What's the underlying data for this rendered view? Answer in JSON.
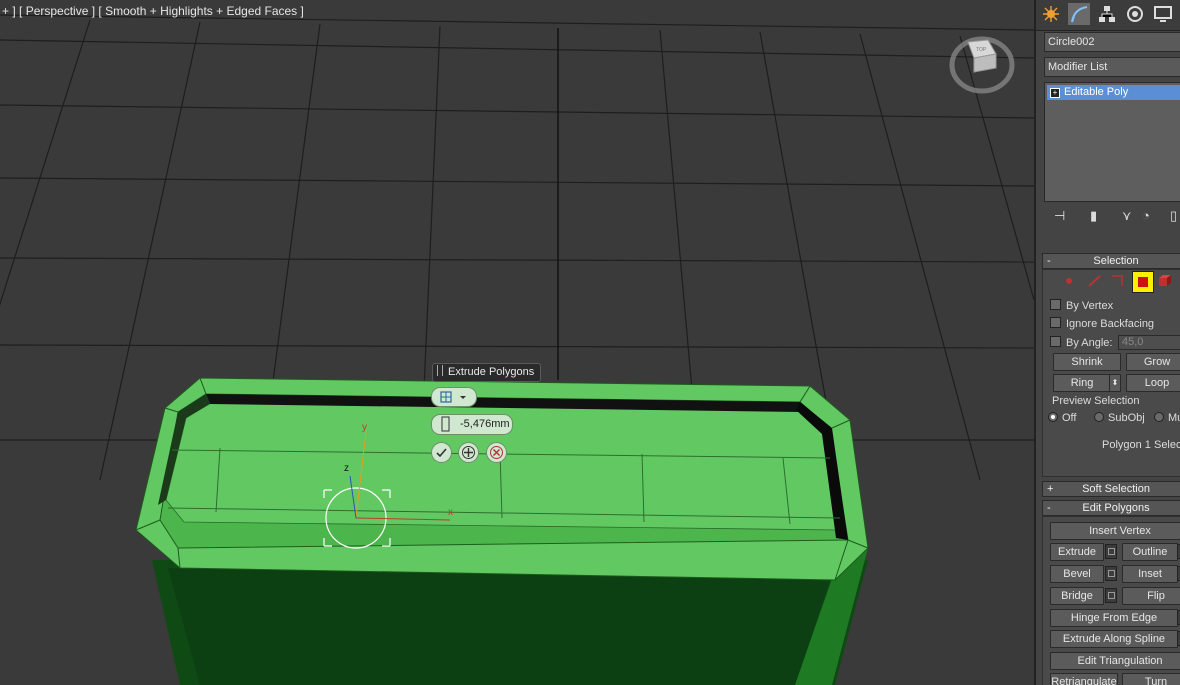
{
  "viewport": {
    "label_parts": [
      "+ ]",
      "[ Perspective ]",
      "[ Smooth + Highlights + Edged Faces ]"
    ],
    "viewcube_label": "TOP"
  },
  "caddy": {
    "title": "Extrude Polygons",
    "height_value": "-5,476mm",
    "ok_icon": "check-icon",
    "apply_icon": "plus-icon",
    "cancel_icon": "x-icon"
  },
  "panel": {
    "tabs": [
      "create-icon",
      "modify-icon",
      "hierarchy-icon",
      "motion-icon",
      "display-icon"
    ],
    "object_name": "Circle002",
    "modifier_list": "Modifier List",
    "stack_item": "Editable Poly",
    "selection": {
      "title": "Selection",
      "by_vertex": "By Vertex",
      "ignore_backfacing": "Ignore Backfacing",
      "by_angle": "By Angle:",
      "angle_value": "45,0",
      "shrink": "Shrink",
      "grow": "Grow",
      "ring": "Ring",
      "loop": "Loop",
      "preview_selection": "Preview Selection",
      "preview_off": "Off",
      "preview_subobj": "SubObj",
      "preview_multi": "Mu",
      "status": "Polygon 1 Selecte"
    },
    "soft_selection": {
      "title": "Soft Selection",
      "sign": "+"
    },
    "edit_polygons": {
      "title": "Edit Polygons",
      "sign": "-",
      "insert_vertex": "Insert Vertex",
      "extrude": "Extrude",
      "outline": "Outline",
      "bevel": "Bevel",
      "inset": "Inset",
      "bridge": "Bridge",
      "flip": "Flip",
      "hinge_from_edge": "Hinge From Edge",
      "extrude_along_spline": "Extrude Along Spline",
      "edit_triangulation": "Edit Triangulation",
      "retriangulate": "Retriangulate",
      "turn": "Turn"
    }
  },
  "colors": {
    "viewport_bg": "#3a3a3a",
    "grid": "#1e1e1e",
    "object_face": "#5fc85f",
    "object_side": "#0f4a14",
    "selected_stack": "#5a8fd6",
    "active_selection": "#ffee00"
  }
}
